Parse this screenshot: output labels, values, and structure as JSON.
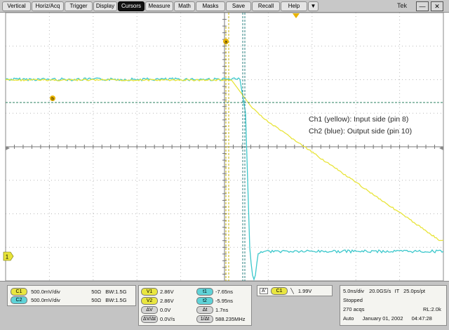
{
  "menu": {
    "items": [
      "Vertical",
      "Horiz/Acq",
      "Trigger",
      "Display",
      "Cursors",
      "Measure",
      "Math",
      "Masks",
      "Save",
      "Recall",
      "Help"
    ],
    "active": "Cursors",
    "dropdown_glyph": "▼",
    "brand": "Tek",
    "minimize_glyph": "—",
    "close_glyph": "✕"
  },
  "annotations": {
    "line1": "Ch1 (yellow): Input side (pin 8)",
    "line2": "Ch2 (blue): Output side (pin 10)"
  },
  "markers": {
    "ch1_ground": "1",
    "cursor_a": "a",
    "cursor_b": "b"
  },
  "channels": {
    "c1": {
      "badge": "C1",
      "scale": "500.0mV/div",
      "impedance": "50Ω",
      "bw_label": "BW",
      "bw": ":1.5G",
      "color": "#e8e43a"
    },
    "c2": {
      "badge": "C2",
      "scale": "500.0mV/div",
      "impedance": "50Ω",
      "bw_label": "BW",
      "bw": ":1.5G",
      "color": "#3cc8cc"
    }
  },
  "cursors": {
    "v1_label": "V1",
    "v1": "2.86V",
    "v2_label": "V2",
    "v2": "2.86V",
    "dv_label": "ΔV",
    "dv": "0.0V",
    "dvdt_label": "ΔV/Δt",
    "dvdt": "0.0V/s",
    "t1_label": "t1",
    "t1": "-7.65ns",
    "t2_label": "t2",
    "t2": "-5.95ns",
    "dt_label": "Δt",
    "dt": "1.7ns",
    "inv_dt_label": "1/Δt",
    "inv_dt": "588.235MHz"
  },
  "trigger": {
    "a_label": "A'",
    "channel": "C1",
    "slope_glyph": "╲",
    "level": "1.99V"
  },
  "acquisition": {
    "timebase": "5.0ns/div",
    "sample_rate": "20.0GS/s",
    "mode": "IT",
    "resolution": "25.0ps/pt",
    "state": "Stopped",
    "acqs": "270 acqs",
    "record_length": "RL:2.0k",
    "auto": "Auto",
    "date": "January 01, 2002",
    "time": "04:47:28"
  }
}
